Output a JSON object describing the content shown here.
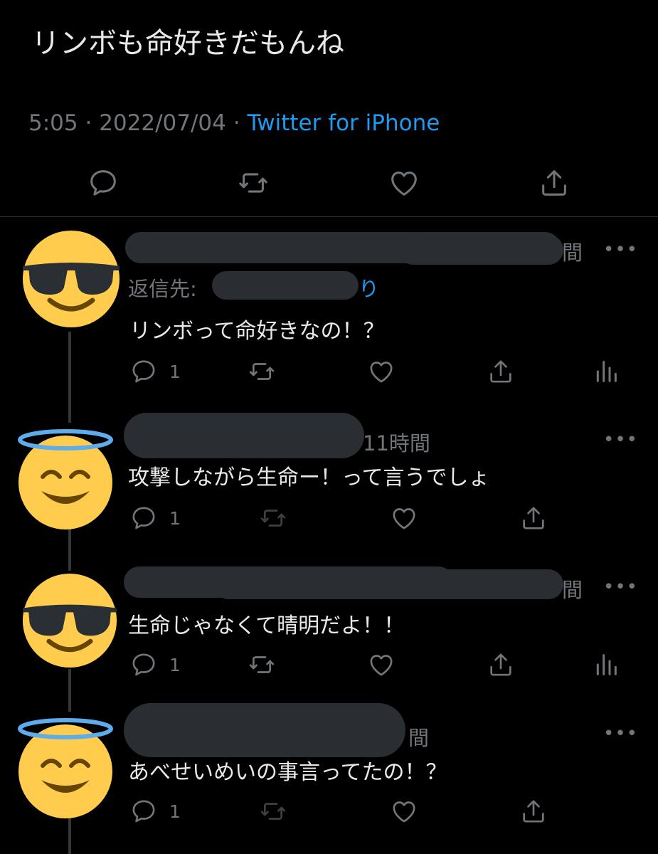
{
  "tweet": {
    "text": "リンボも命好きだもんね",
    "time": "5:05",
    "sep1": " · ",
    "date": "2022/07/04",
    "sep2": " · ",
    "source": "Twitter for iPhone"
  },
  "replies": [
    {
      "avatar": "sunglasses-emoji",
      "time_fragment": "間",
      "reply_label": "返信先:",
      "reply_handle_tail": "り",
      "text": "リンボって命好きなの！？",
      "reply_count": "1",
      "more": "•••"
    },
    {
      "avatar": "halo-emoji",
      "time_fragment": "11時間",
      "text": "攻撃しながら生命ー！って言うでしょ",
      "reply_count": "1",
      "more": "•••"
    },
    {
      "avatar": "sunglasses-emoji",
      "time_fragment": "間",
      "text": "生命じゃなくて晴明だよ！！",
      "reply_count": "1",
      "more": "•••"
    },
    {
      "avatar": "halo-emoji",
      "time_fragment": "間",
      "text": "あべせいめいの事言ってたの！？",
      "reply_count": "1",
      "more": "•••"
    }
  ],
  "colors": {
    "background": "#000000",
    "text": "#e7e9ea",
    "muted": "#71767b",
    "link": "#1d9bf0",
    "emoji": "#ffcc4d"
  }
}
